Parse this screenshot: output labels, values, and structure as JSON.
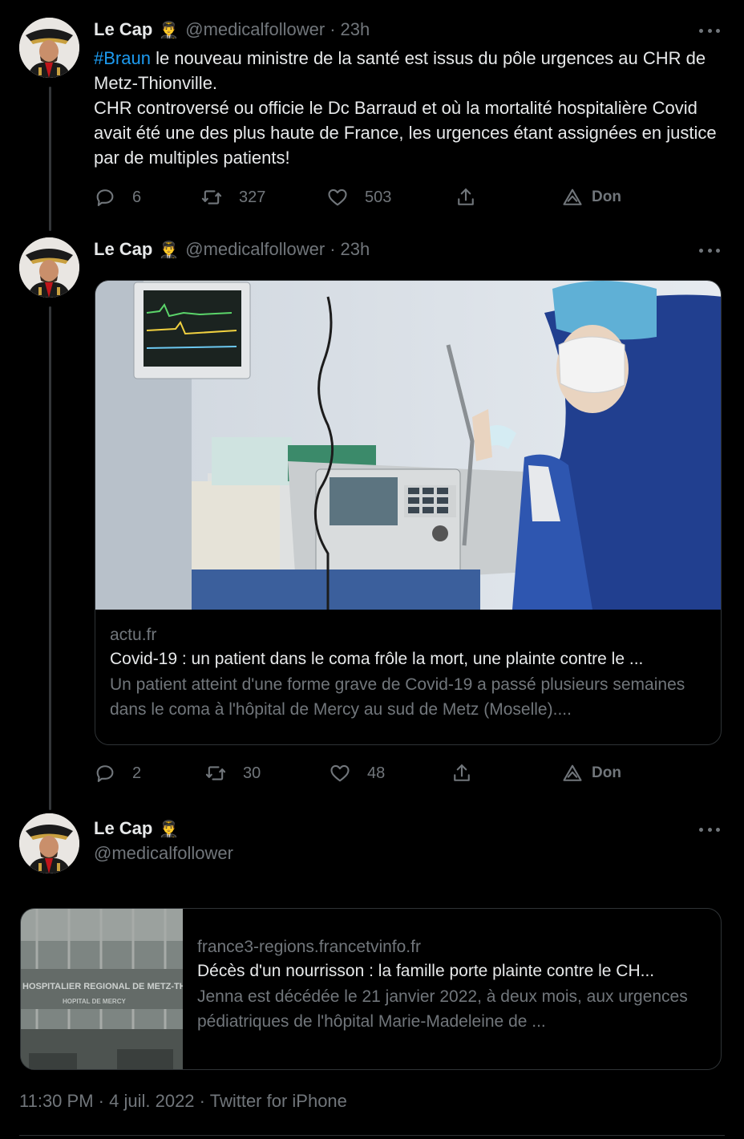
{
  "tweets": [
    {
      "name": "Le Cap",
      "emoji": "👨‍✈️",
      "handle": "@medicalfollower",
      "time": "23h",
      "hashtag": "#Braun",
      "text_rest": " le nouveau ministre de la santé est issus du pôle urgences au CHR de Metz-Thionville.",
      "text_line2": "CHR controversé ou officie le Dc Barraud et où la mortalité hospitalière Covid avait été une des plus haute de France, les urgences étant assignées en justice par de multiples patients!",
      "replies": "6",
      "retweets": "327",
      "likes": "503",
      "tip_label": "Don"
    },
    {
      "name": "Le Cap",
      "emoji": "👨‍✈️",
      "handle": "@medicalfollower",
      "time": "23h",
      "card": {
        "domain": "actu.fr",
        "title": "Covid-19 : un patient dans le coma frôle la mort, une plainte contre le ...",
        "description": "Un patient atteint d'une forme grave de Covid-19 a passé plusieurs semaines dans le coma à l'hôpital de Mercy au sud de Metz (Moselle)...."
      },
      "replies": "2",
      "retweets": "30",
      "likes": "48",
      "tip_label": "Don"
    },
    {
      "name": "Le Cap",
      "emoji": "👨‍✈️",
      "handle": "@medicalfollower",
      "card": {
        "domain": "france3-regions.francetvinfo.fr",
        "title": "Décès d'un nourrisson : la famille porte plainte contre le CH...",
        "description": "Jenna est décédée le 21 janvier 2022, à deux mois, aux urgences pédiatriques de l'hôpital Marie-Madeleine de ...",
        "image_sign_line1": "HOSPITALIER REGIONAL DE METZ-TH",
        "image_sign_line2": "HOPITAL DE MERCY"
      }
    }
  ],
  "footer": {
    "time": "11:30 PM",
    "date": "4 juil. 2022",
    "source": "Twitter for iPhone"
  }
}
